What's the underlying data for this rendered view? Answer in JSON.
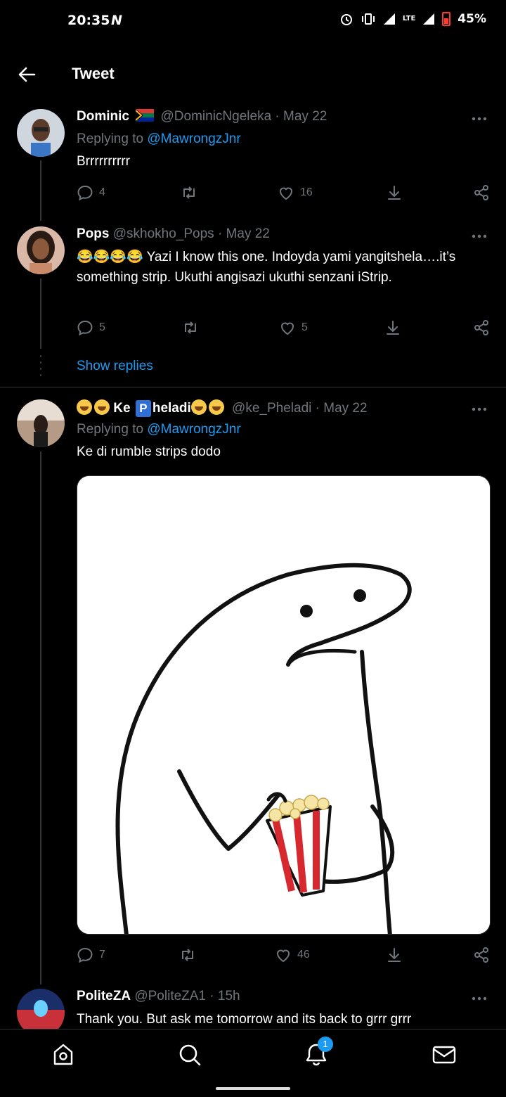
{
  "status_bar": {
    "time": "20:35",
    "lte": "LTE",
    "battery": "45%"
  },
  "header": {
    "title": "Tweet"
  },
  "tweets": [
    {
      "name": "Dominic",
      "handle": "@DominicNgeleka",
      "date": "· May 22",
      "replying_prefix": "Replying to ",
      "replying_to": "@MawrongzJnr",
      "text": "Brrrrrrrrrr",
      "replies": "4",
      "likes": "16"
    },
    {
      "name": "Pops",
      "handle": "@skhokho_Pops",
      "date": "· May 22",
      "text": "😂😂😂😂 Yazi I know this one. Indoyda yami yangitshela….it’s something strip. Ukuthi angisazi ukuthi senzani iStrip.",
      "replies": "5",
      "likes": "5",
      "show_replies": "Show replies"
    },
    {
      "name_part1": "Ke",
      "name_part2": "heladi",
      "badge": "P",
      "handle": "@ke_Pheladi",
      "date": "· May 22",
      "replying_prefix": "Replying to ",
      "replying_to": "@MawrongzJnr",
      "text": "Ke di rumble strips dodo",
      "replies": "7",
      "likes": "46"
    },
    {
      "name": "PoliteZA",
      "handle": "@PoliteZA1",
      "date": "· 15h",
      "text": "Thank you. But ask me tomorrow and its back to grrr grrr"
    }
  ],
  "nav": {
    "notification_count": "1"
  },
  "icons": [
    "back-arrow-icon",
    "more-icon",
    "reply-icon",
    "retweet-icon",
    "like-icon",
    "share-icon",
    "download-icon",
    "home-icon",
    "search-icon",
    "bell-icon",
    "mail-icon"
  ]
}
